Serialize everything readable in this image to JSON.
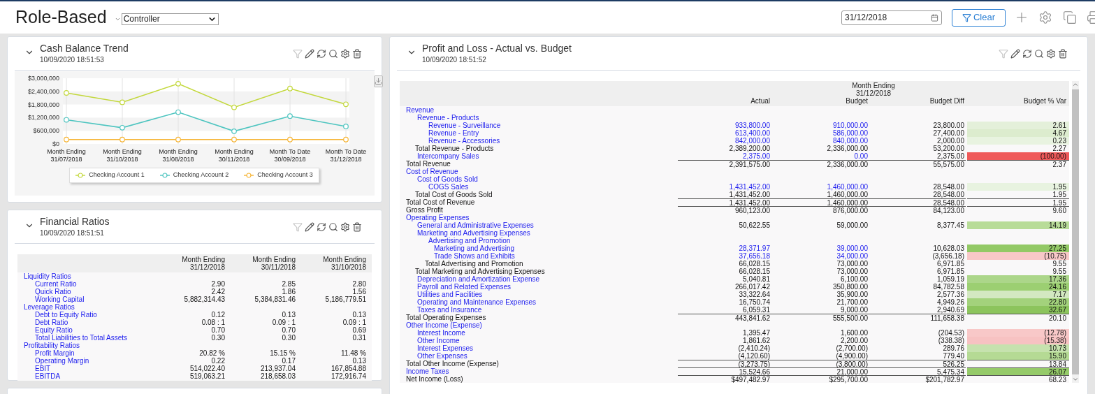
{
  "header": {
    "title": "Role-Based",
    "role_select": {
      "value": "Controller"
    },
    "date_field": {
      "value": "31/12/2018"
    },
    "clear_button": {
      "label": "Clear"
    }
  },
  "cash_card": {
    "title": "Cash Balance Trend",
    "timestamp": "10/09/2020 18:51:53",
    "chart_data": {
      "type": "line",
      "grid": true,
      "legend": true,
      "categories": [
        "Month Ending 31/07/2018",
        "Month Ending 31/10/2018",
        "Month Ending 31/08/2018",
        "Month Ending 30/11/2018",
        "Month To Date 30/09/2018",
        "Month To Date 31/12/2018"
      ],
      "series": [
        {
          "name": "Checking Account 1",
          "color": "#c3d83c",
          "marker": "circle",
          "values": [
            2330000,
            1900000,
            2750000,
            1670000,
            2530000,
            1810000
          ]
        },
        {
          "name": "Checking Account 2",
          "color": "#4ec5c0",
          "marker": "circle",
          "values": [
            1100000,
            740000,
            1450000,
            580000,
            1270000,
            800000
          ]
        },
        {
          "name": "Checking Account 3",
          "color": "#f6b536",
          "marker": "circle",
          "values": [
            200000,
            200000,
            200000,
            200000,
            200000,
            200000
          ]
        }
      ],
      "ylim": [
        0,
        3000000
      ],
      "yticks": [
        {
          "value": 0,
          "label": "$0"
        },
        {
          "value": 600000,
          "label": "$600,000"
        },
        {
          "value": 1200000,
          "label": "$1,200,000"
        },
        {
          "value": 1800000,
          "label": "$1,800,000"
        },
        {
          "value": 2400000,
          "label": "$2,400,000"
        },
        {
          "value": 3000000,
          "label": "$3,000,000"
        }
      ]
    }
  },
  "ratios_card": {
    "title": "Financial Ratios",
    "timestamp": "10/09/2020 18:51:51",
    "columns": [
      {
        "label": "Month Ending",
        "date": "31/12/2018"
      },
      {
        "label": "Month Ending",
        "date": "30/11/2018"
      },
      {
        "label": "Month Ending",
        "date": "31/10/2018"
      }
    ],
    "groups": [
      {
        "label": "Liquidity Ratios",
        "children": [
          {
            "label": "Current Ratio",
            "values": [
              "2.90",
              "2.85",
              "2.80"
            ]
          },
          {
            "label": "Quick Ratio",
            "values": [
              "2.42",
              "1.86",
              "1.56"
            ]
          },
          {
            "label": "Working Capital",
            "values": [
              "5,882,314.43",
              "5,384,831.46",
              "5,186,779.51"
            ]
          }
        ]
      },
      {
        "label": "Leverage Ratios",
        "children": [
          {
            "label": "Debt to Equity Ratio",
            "values": [
              "0.12",
              "0.13",
              "0.13"
            ]
          },
          {
            "label": "Debt Ratio",
            "values": [
              "0.08 : 1",
              "0.09 : 1",
              "0.09 : 1"
            ]
          },
          {
            "label": "Equity Ratio",
            "values": [
              "0.70",
              "0.70",
              "0.69"
            ]
          },
          {
            "label": "Total Liabilities to Total Assets",
            "values": [
              "0.30",
              "0.30",
              "0.31"
            ]
          }
        ]
      },
      {
        "label": "Profitability Ratios",
        "children": [
          {
            "label": "Profit Margin",
            "values": [
              "20.82 %",
              "15.15 %",
              "11.48 %"
            ]
          },
          {
            "label": "Operating Margin",
            "values": [
              "0.22",
              "0.17",
              "0.13"
            ]
          },
          {
            "label": "EBIT",
            "values": [
              "514,022.40",
              "213,937.04",
              "167,854.88"
            ]
          },
          {
            "label": "EBITDA",
            "values": [
              "519,063.21",
              "218,658.03",
              "172,916.74"
            ]
          }
        ]
      }
    ]
  },
  "pnl_card": {
    "title": "Profit and Loss - Actual vs. Budget",
    "timestamp": "10/09/2020 18:51:52",
    "period": {
      "label": "Month Ending",
      "date": "31/12/2018"
    },
    "columns": [
      "Actual",
      "Budget",
      "Budget Diff",
      "Budget % Var"
    ],
    "rows": [
      {
        "kind": "header",
        "label": "Revenue",
        "children": [
          {
            "kind": "header",
            "label": "Revenue - Products",
            "children": [
              {
                "kind": "drill",
                "label": "Revenue - Surveillance",
                "values": [
                  "933,800.00",
                  "910,000.00",
                  "23,800.00",
                  "2.61"
                ],
                "color": "#e4f0da",
                "ruled": false
              },
              {
                "kind": "drill",
                "label": "Revenue - Entry",
                "values": [
                  "613,400.00",
                  "586,000.00",
                  "27,400.00",
                  "4.67"
                ],
                "color": "#dcecce",
                "ruled": false
              },
              {
                "kind": "drill",
                "label": "Revenue - Accessories",
                "values": [
                  "842,000.00",
                  "840,000.00",
                  "2,000.00",
                  "0.23"
                ],
                "color": "#e8f3e0",
                "ruled": false
              }
            ]
          },
          {
            "kind": "total",
            "label": "Total Revenue - Products",
            "values": [
              "2,389,200.00",
              "2,336,000.00",
              "53,200.00",
              "2.27"
            ],
            "ruled": false
          },
          {
            "kind": "drill",
            "label": "Intercompany Sales",
            "values": [
              "2,375.00",
              "0.00",
              "2,375.00",
              "(100.00)"
            ],
            "color": "#ef5a5a",
            "ruled": false
          }
        ]
      },
      {
        "kind": "total",
        "label": "Total Revenue",
        "values": [
          "2,391,575.00",
          "2,336,000.00",
          "55,575.00",
          "2.37"
        ],
        "ruled": true
      },
      {
        "kind": "header",
        "label": "Cost of Revenue",
        "children": [
          {
            "kind": "header",
            "label": "Cost of Goods Sold",
            "children": [
              {
                "kind": "drill",
                "label": "COGS Sales",
                "values": [
                  "1,431,452.00",
                  "1,460,000.00",
                  "28,548.00",
                  "1.95"
                ],
                "color": "#e8f3e0",
                "ruled": false
              }
            ]
          },
          {
            "kind": "total",
            "label": "Total Cost of Goods Sold",
            "values": [
              "1,431,452.00",
              "1,460,000.00",
              "28,548.00",
              "1.95"
            ],
            "ruled": false
          }
        ]
      },
      {
        "kind": "total",
        "label": "Total Cost of Revenue",
        "values": [
          "1,431,452.00",
          "1,460,000.00",
          "28,548.00",
          "1.95"
        ],
        "ruled": true
      },
      {
        "kind": "total",
        "label": "Gross Profit",
        "values": [
          "960,123.00",
          "876,000.00",
          "84,123.00",
          "9.60"
        ],
        "ruled": true
      },
      {
        "kind": "header",
        "label": "Operating Expenses",
        "children": [
          {
            "kind": "account",
            "label": "General and Administrative Expenses",
            "values": [
              "50,622.55",
              "59,000.00",
              "8,377.45",
              "14.19"
            ],
            "color": "#b8dc98",
            "ruled": false
          },
          {
            "kind": "header",
            "label": "Marketing and Advertising Expenses",
            "children": [
              {
                "kind": "header",
                "label": "Advertising and Promotion",
                "children": [
                  {
                    "kind": "drill",
                    "label": "Marketing and Advertising",
                    "values": [
                      "28,371.97",
                      "39,000.00",
                      "10,628.03",
                      "27.25"
                    ],
                    "color": "#93c966",
                    "ruled": false
                  },
                  {
                    "kind": "drill",
                    "label": "Trade Shows and Exhibits",
                    "values": [
                      "37,656.18",
                      "34,000.00",
                      "(3,656.18)",
                      "(10.75)"
                    ],
                    "color": "#f8c8c8",
                    "ruled": false
                  }
                ]
              },
              {
                "kind": "total",
                "label": "Total Advertising and Promotion",
                "values": [
                  "66,028.15",
                  "73,000.00",
                  "6,971.85",
                  "9.55"
                ],
                "ruled": false
              }
            ]
          },
          {
            "kind": "total",
            "label": "Total Marketing and Advertising Expenses",
            "values": [
              "66,028.15",
              "73,000.00",
              "6,971.85",
              "9.55"
            ],
            "ruled": false
          },
          {
            "kind": "account",
            "label": "Depreciation and Amortization Expense",
            "values": [
              "5,040.81",
              "6,100.00",
              "1,059.19",
              "17.36"
            ],
            "color": "#acd68a",
            "ruled": false
          },
          {
            "kind": "account",
            "label": "Payroll and Related Expenses",
            "values": [
              "266,017.42",
              "350,800.00",
              "84,782.58",
              "24.16"
            ],
            "color": "#9ccf72",
            "ruled": false
          },
          {
            "kind": "account",
            "label": "Utilities and Facilities",
            "values": [
              "33,322.64",
              "35,900.00",
              "2,577.36",
              "7.17"
            ],
            "color": "#d3e8c1",
            "ruled": false
          },
          {
            "kind": "account",
            "label": "Operating and Maintenance Expenses",
            "values": [
              "16,750.74",
              "21,700.00",
              "4,949.26",
              "22.80"
            ],
            "color": "#a3d27c",
            "ruled": false
          },
          {
            "kind": "account",
            "label": "Taxes and Insurance",
            "values": [
              "6,059.31",
              "9,000.00",
              "2,940.69",
              "32.67"
            ],
            "color": "#8cc45d",
            "ruled": false
          }
        ]
      },
      {
        "kind": "total",
        "label": "Total Operating Expenses",
        "values": [
          "443,841.62",
          "555,500.00",
          "111,658.38",
          "20.10"
        ],
        "ruled": true
      },
      {
        "kind": "header",
        "label": "Other Income (Expense)",
        "children": [
          {
            "kind": "account",
            "label": "Interest Income",
            "values": [
              "1,395.47",
              "1,600.00",
              "(204.53)",
              "(12.78)"
            ],
            "color": "#f8c8c8",
            "ruled": false
          },
          {
            "kind": "account",
            "label": "Other Income",
            "values": [
              "1,861.62",
              "2,200.00",
              "(338.38)",
              "(15.38)"
            ],
            "color": "#f7c2c2",
            "ruled": false
          },
          {
            "kind": "account",
            "label": "Interest Expenses",
            "values": [
              "(2,410.24)",
              "(2,700.00)",
              "289.76",
              "10.73"
            ],
            "color": "#c6e2ae",
            "ruled": false
          },
          {
            "kind": "account",
            "label": "Other Expenses",
            "values": [
              "(4,120.60)",
              "(4,900.00)",
              "779.40",
              "15.90"
            ],
            "color": "#b5da94",
            "ruled": false
          }
        ]
      },
      {
        "kind": "total",
        "label": "Total Other Income (Expense)",
        "values": [
          "(3,273.75)",
          "(3,800.00)",
          "526.25",
          "13.84"
        ],
        "ruled": true
      },
      {
        "kind": "account",
        "label": "Income Taxes",
        "values": [
          "15,524.66",
          "21,000.00",
          "5,475.34",
          "26.07"
        ],
        "color": "#95ca69",
        "ruled": true
      },
      {
        "kind": "total",
        "label": "Net Income (Loss)",
        "values": [
          "$497,482.97",
          "$295,700.00",
          "$201,782.97",
          "68.23"
        ],
        "ruled": true
      }
    ]
  }
}
